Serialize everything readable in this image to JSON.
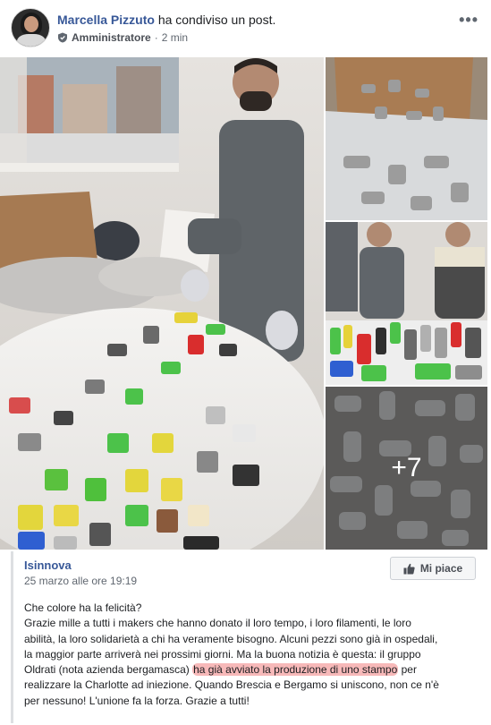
{
  "header": {
    "author": "Marcella Pizzuto",
    "action": "ha condiviso un post.",
    "role": "Amministratore",
    "separator": "·",
    "time": "2 min",
    "more_icon": "more-horizontal-icon"
  },
  "gallery": {
    "extra_count": "+7"
  },
  "shared_post": {
    "page_name": "Isinnova",
    "date": "25 marzo alle ore 19:19",
    "like_label": "Mi piace",
    "lines": [
      "Che colore ha la felicità?",
      "Grazie mille a tutti i makers che hanno donato il loro tempo, i loro filamenti, le loro",
      "abilità, la loro solidarietà a chi ha veramente bisogno. Alcuni pezzi sono già in ospedali,",
      "la maggior parte arriverà nei prossimi giorni. Ma la buona notizia è questa: il gruppo"
    ],
    "line5_before": "Oldrati (nota azienda bergamasca) ",
    "line5_highlight": "ha già avviato la produzione di uno stampo",
    "line5_after": " per",
    "line6": "realizzare la Charlotte ad iniezione. Quando Brescia e Bergamo si uniscono, non ce n'è",
    "line7": "per nessuno! L'unione fa la forza. Grazie a tutti!"
  },
  "colors": {
    "link": "#385898",
    "highlight": "#f08080",
    "meta": "#606770"
  }
}
